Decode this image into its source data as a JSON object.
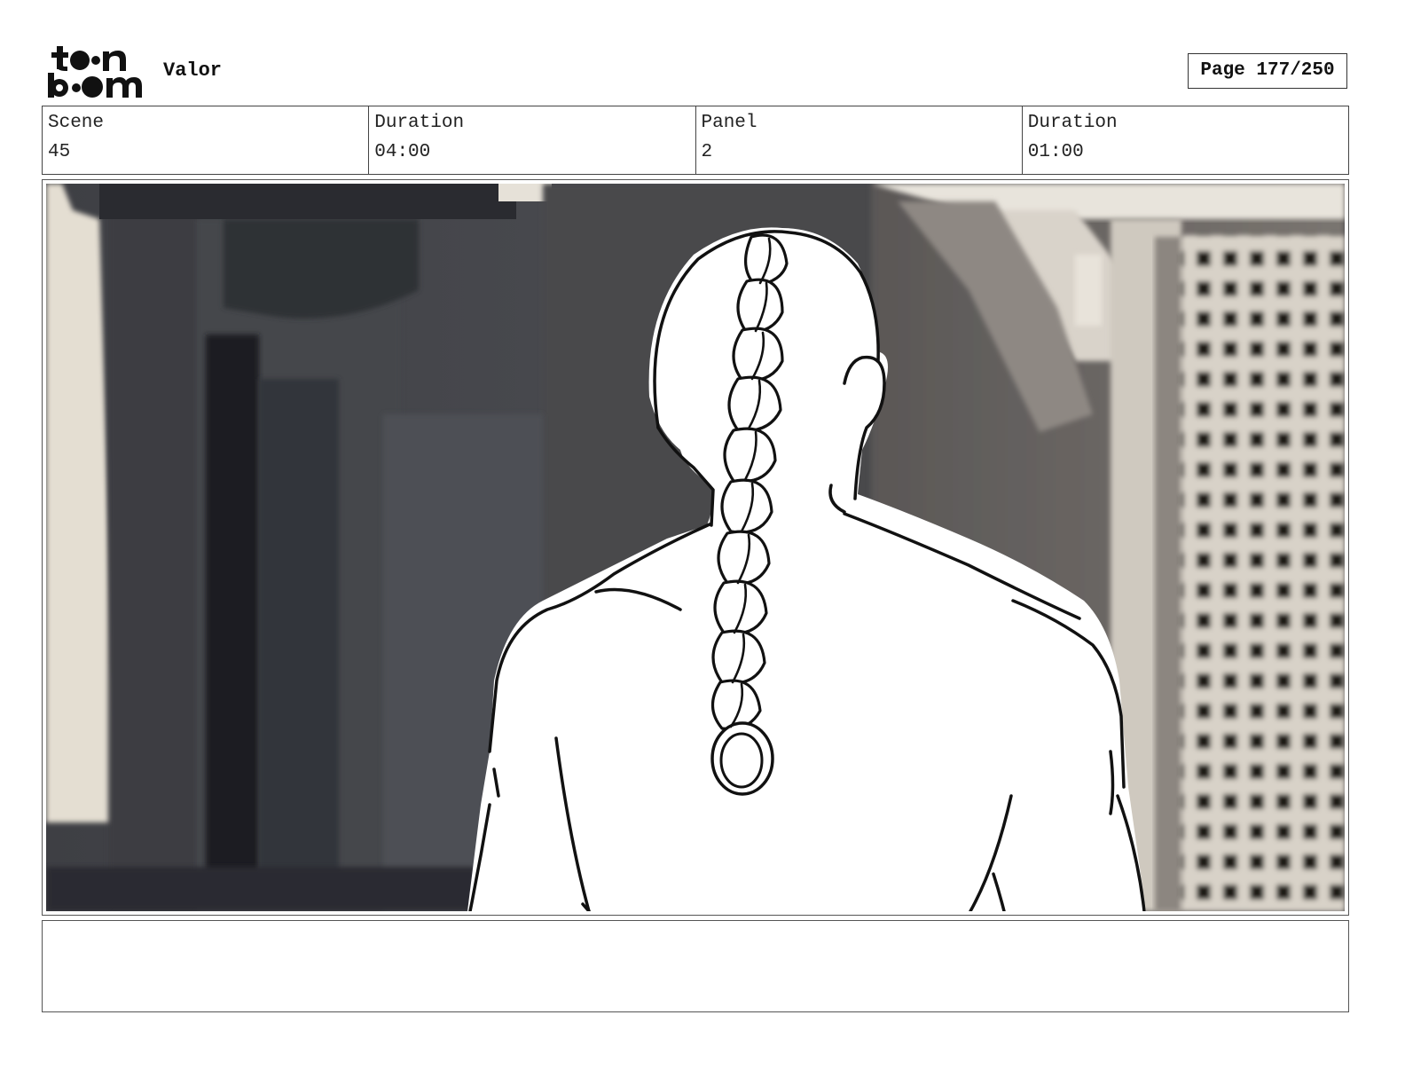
{
  "header": {
    "logo_alt": "toon boom",
    "project_title": "Valor",
    "page_indicator": "Page 177/250"
  },
  "info": {
    "scene_label": "Scene",
    "scene_value": "45",
    "scene_duration_label": "Duration",
    "scene_duration_value": "04:00",
    "panel_label": "Panel",
    "panel_value": "2",
    "panel_duration_label": "Duration",
    "panel_duration_value": "01:00"
  },
  "notes": {
    "text": ""
  }
}
